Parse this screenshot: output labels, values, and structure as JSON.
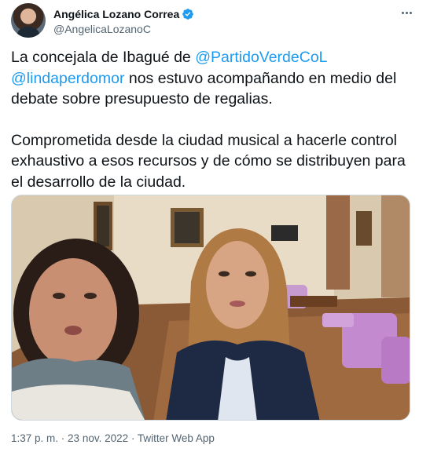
{
  "user": {
    "display_name": "Angélica Lozano Correa",
    "handle": "@AngelicaLozanoC",
    "verified": true
  },
  "colors": {
    "accent": "#1d9bf0",
    "text": "#0f1419",
    "secondary": "#536471"
  },
  "icons": {
    "verified": "verified-badge-icon",
    "more": "more-options-icon"
  },
  "tweet": {
    "p1_pre": "La concejala de Ibagué de ",
    "mention1": "@PartidoVerdeCoL",
    "mention2": "@lindaperdomor",
    "p1_post": " nos estuvo acompañando en medio del debate sobre presupuesto de regalias.",
    "p2": "Comprometida desde la ciudad musical a hacerle control exhaustivo a esos recursos y de cómo se distribuyen para el desarrollo de la ciudad."
  },
  "meta": {
    "time": "1:37 p. m.",
    "separator1": " · ",
    "date": "23 nov. 2022",
    "separator2": " · ",
    "source": "Twitter Web App"
  }
}
